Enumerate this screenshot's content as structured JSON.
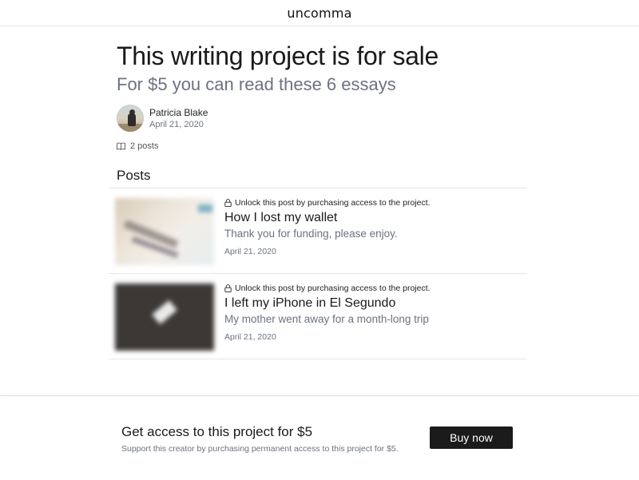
{
  "header": {
    "brand": "uncomma"
  },
  "project": {
    "title": "This writing project is for sale",
    "subtitle": "For $5 you can read these 6 essays",
    "author": {
      "name": "Patricia Blake",
      "date": "April 21, 2020"
    },
    "posts_count": "2 posts"
  },
  "posts_section": {
    "heading": "Posts",
    "items": [
      {
        "lock_text": "Unlock this post by purchasing access to the project.",
        "title": "How I lost my wallet",
        "excerpt": "Thank you for funding, please enjoy.",
        "date": "April 21, 2020",
        "thumbnail": "blurred-paper-photo"
      },
      {
        "lock_text": "Unlock this post by purchasing access to the project.",
        "title": "I left my iPhone in El Segundo",
        "excerpt": "My mother went away for a month-long trip",
        "date": "April 21, 2020",
        "thumbnail": "blurred-dark-photo"
      }
    ]
  },
  "footer": {
    "title": "Get access to this project for $5",
    "subtitle": "Support this creator by purchasing permanent access to this project for $5.",
    "buy_label": "Buy now"
  },
  "colors": {
    "text_primary": "#1a1a1a",
    "text_muted": "#6b7280",
    "button_bg": "#1b1b1b",
    "divider": "#e6e6e6"
  }
}
